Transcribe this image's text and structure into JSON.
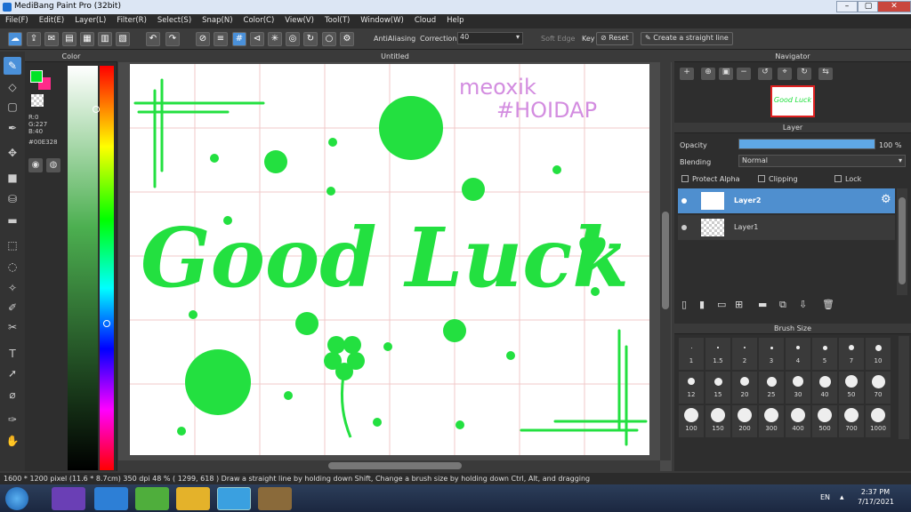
{
  "window": {
    "title": "MediBang Paint Pro (32bit)",
    "buttons": [
      "–",
      "▢",
      "✕"
    ]
  },
  "menu": [
    "File(F)",
    "Edit(E)",
    "Layer(L)",
    "Filter(R)",
    "Select(S)",
    "Snap(N)",
    "Color(C)",
    "View(V)",
    "Tool(T)",
    "Window(W)",
    "Cloud",
    "Help"
  ],
  "toolbar": {
    "antialiasing_label": "AntiAliasing",
    "correction_label": "Correction",
    "correction_value": "40",
    "soft_edge_label": "Soft Edge",
    "key_label": "Key",
    "reset_label": "Reset",
    "straight_line_label": "Create a straight line"
  },
  "color_panel": {
    "title": "Color",
    "r": "R:0",
    "g": "G:227",
    "b": "B:40",
    "hex": "#00E328",
    "primary_color": "#00E328",
    "secondary_color": "#FF2A8A"
  },
  "canvas": {
    "title": "Untitled",
    "greeting": "Good Luck",
    "signature_line1": "meoxik",
    "signature_line2": "#HOIDAP",
    "ink_color": "#23E040",
    "signature_color": "#D38DE0"
  },
  "navigator": {
    "title": "Navigator"
  },
  "layer_panel": {
    "title": "Layer",
    "opacity_label": "Opacity",
    "opacity_value": "100 %",
    "opacity": 1.0,
    "blending_label": "Blending",
    "blending_value": "Normal",
    "protect_alpha": "Protect Alpha",
    "clipping": "Clipping",
    "lock": "Lock",
    "layers": [
      {
        "name": "Layer2",
        "selected": true
      },
      {
        "name": "Layer1",
        "selected": false
      }
    ]
  },
  "brush_size": {
    "title": "Brush Size",
    "sizes": [
      "1",
      "1.5",
      "2",
      "3",
      "4",
      "5",
      "7",
      "10",
      "12",
      "15",
      "20",
      "25",
      "30",
      "40",
      "50",
      "70",
      "100",
      "150",
      "200",
      "300",
      "400",
      "500",
      "700",
      "1000"
    ]
  },
  "status": {
    "text": "1600 * 1200 pixel  (11.6 * 8.7cm)  350 dpi  48 %  ( 1299, 618 )  Draw a straight line by holding down Shift, Change a brush size by holding down Ctrl, Alt, and dragging"
  },
  "taskbar": {
    "lang": "EN",
    "time": "2:37 PM",
    "date": "7/17/2021"
  }
}
